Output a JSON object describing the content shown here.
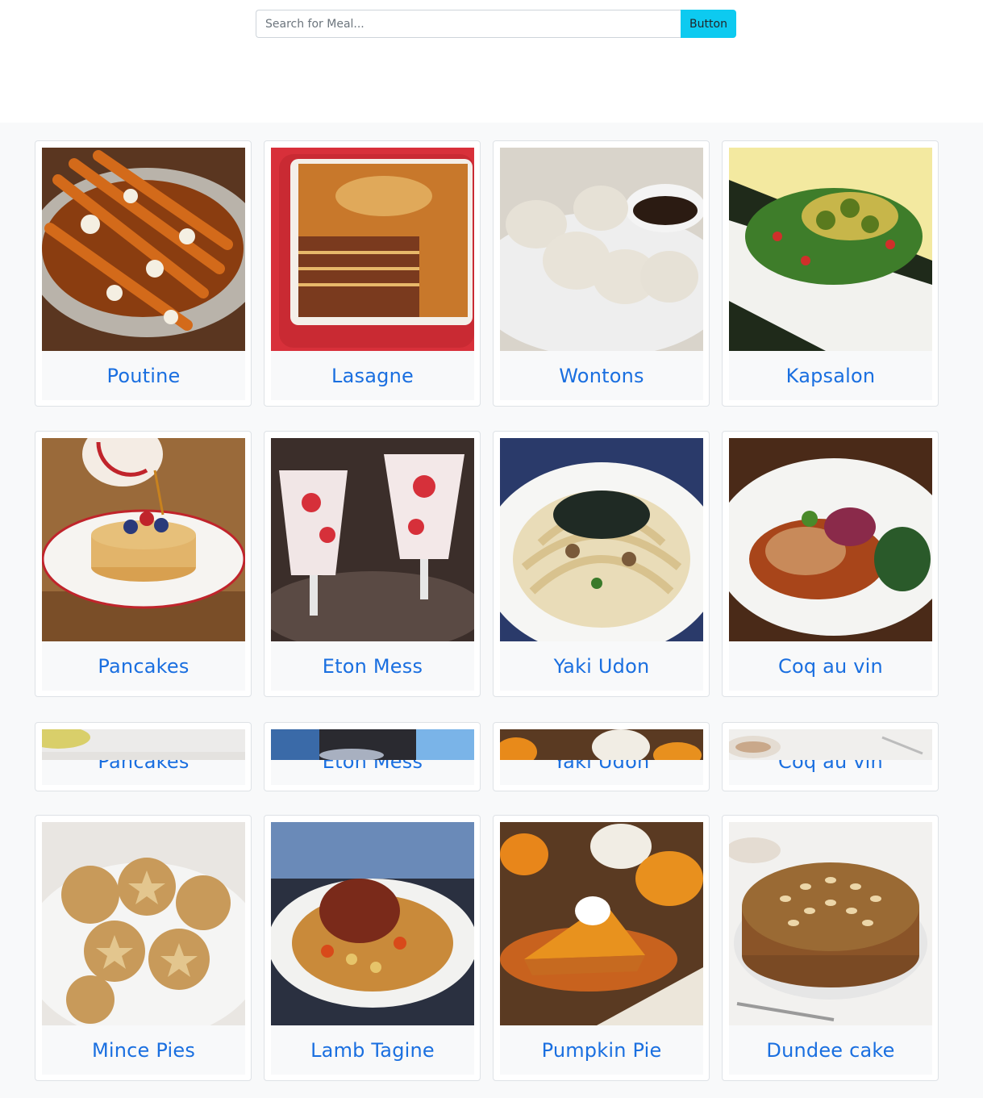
{
  "search": {
    "placeholder": "Search for Meal...",
    "value": "",
    "button_label": "Button"
  },
  "meals": [
    {
      "title": "Poutine",
      "img": "poutine"
    },
    {
      "title": "Lasagne",
      "img": "lasagne"
    },
    {
      "title": "Wontons",
      "img": "wontons"
    },
    {
      "title": "Kapsalon",
      "img": "kapsalon"
    },
    {
      "title": "Pancakes",
      "img": "pancakes"
    },
    {
      "title": "Eton Mess",
      "img": "eton-mess"
    },
    {
      "title": "Yaki Udon",
      "img": "yaki-udon"
    },
    {
      "title": "Coq au vin",
      "img": "coq-au-vin"
    },
    {
      "title": "Pancakes",
      "img": "mince-pies-partial"
    },
    {
      "title": "Eton Mess",
      "img": "lamb-tagine-partial"
    },
    {
      "title": "Yaki Udon",
      "img": "pumpkin-pie-partial"
    },
    {
      "title": "Coq au vin",
      "img": "dundee-cake-partial"
    },
    {
      "title": "Mince Pies",
      "img": "mince-pies"
    },
    {
      "title": "Lamb Tagine",
      "img": "lamb-tagine"
    },
    {
      "title": "Pumpkin Pie",
      "img": "pumpkin-pie"
    },
    {
      "title": "Dundee cake",
      "img": "dundee-cake"
    }
  ]
}
